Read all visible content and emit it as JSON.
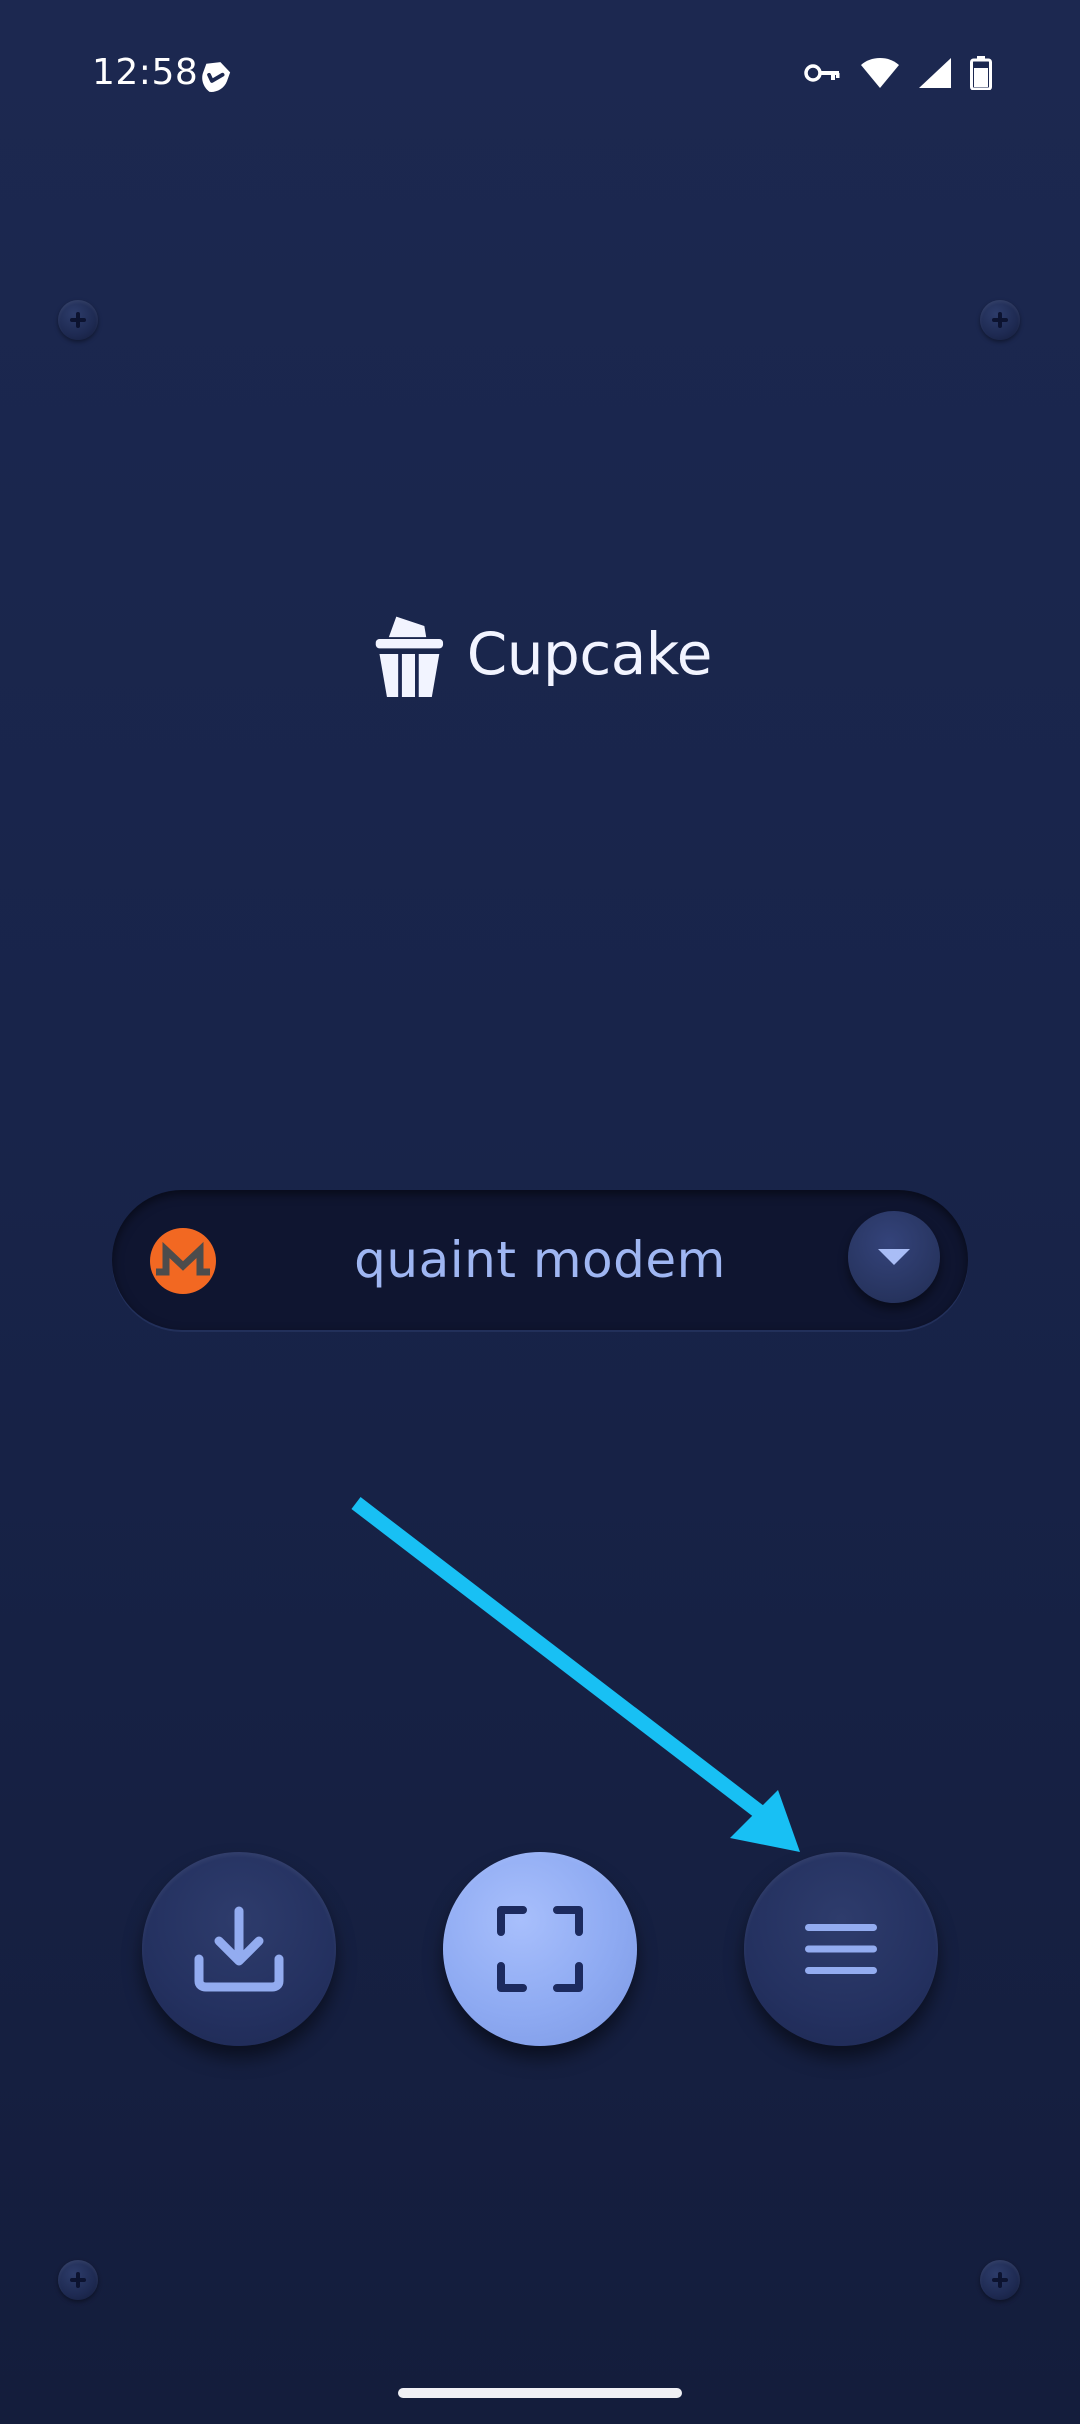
{
  "status_bar": {
    "time": "12:58",
    "icons": [
      "shield-check-icon",
      "vpn-key-icon",
      "wifi-icon",
      "cellular-signal-icon",
      "battery-icon"
    ]
  },
  "app": {
    "logo_text": "Cupcake",
    "logo_icon": "cupcake-icon"
  },
  "wallet_selector": {
    "wallet_name": "quaint modem",
    "coin_icon": "monero-icon",
    "dropdown_icon": "caret-down-icon"
  },
  "actions": {
    "import_icon": "download-tray-icon",
    "scan_icon": "scan-frame-icon",
    "menu_icon": "hamburger-menu-icon"
  },
  "colors": {
    "background": "#1a2550",
    "accent": "#8eaaf2",
    "monero_orange": "#f26822",
    "annotation_arrow": "#18c0f4",
    "wallet_text": "#9fb6f2"
  }
}
